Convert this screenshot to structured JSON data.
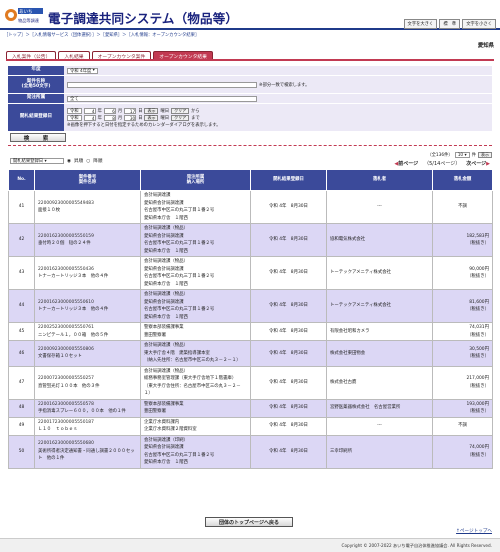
{
  "header": {
    "logo_text": "あいち物品等調達",
    "title": "電子調達共同システム（物品等）",
    "font_size_buttons": [
      "文字を大きく",
      "標　準",
      "文字を小さく"
    ]
  },
  "breadcrumb": "［トップ］＞［入札情報サービス（団体選択）］＞［愛知県］＞［入札情報：オープンカウンタ結果］",
  "region": "愛知県",
  "tabs": [
    {
      "label": "入札案件（公告）",
      "active": false
    },
    {
      "label": "入札結果",
      "active": false
    },
    {
      "label": "オープンカウンタ案件",
      "active": false
    },
    {
      "label": "オープンカウンタ結果",
      "active": true
    }
  ],
  "search": {
    "year_label": "年度",
    "year_value": "令和 4年度",
    "name_label": "案件名称\n(全角50文字)",
    "name_note": "※部分一致で検索します。",
    "dept_label": "発注所属",
    "dept_value": "全て",
    "date_label": "開札結果登録日",
    "from": {
      "era": "令和",
      "year": "4",
      "month": "6",
      "day": "17",
      "cal": "表示",
      "clear": "クリア",
      "suffix": "から"
    },
    "to": {
      "era": "令和",
      "year": "4",
      "month": "8",
      "day": "30",
      "cal": "表示",
      "clear": "クリア",
      "suffix": "まで"
    },
    "date_note": "※画像を押下すると日付を指定するためのカレンダーダイアログを表示します。",
    "search_button": "検　索"
  },
  "controls": {
    "sort_value": "開札結果登録日",
    "asc": "昇順",
    "desc": "降順",
    "total": "（全136件）",
    "per_page": "10",
    "per_page_suffix": "件",
    "display": "表示",
    "prev": "前ページ",
    "page": "（5/14ページ）",
    "next": "次ページ"
  },
  "table": {
    "headers": [
      "No.",
      "案件番号\n案件名称",
      "発注所属\n納入場所",
      "開札結果登録日",
      "落札者",
      "落札金額"
    ],
    "rows": [
      {
        "no": "41",
        "id": "22000923000005549483",
        "name": "面接１０枚",
        "dept": [
          "会計局調達課",
          "愛知県会計局調達課",
          "名古屋市中区三の丸三丁目１番２号",
          "愛知県本庁舎　１階西"
        ],
        "date": "令和 4年　8月30日",
        "winner": "---",
        "amount": [
          "不調"
        ]
      },
      {
        "no": "42",
        "id": "22001623000005550159",
        "name": "垂付時２０個　短の２４件",
        "dept": [
          "会計局調達課（物品）",
          "愛知県会計局調達課",
          "名古屋市中区三の丸三丁目１番２号",
          "愛知県本庁舎　１階西"
        ],
        "date": "令和 4年　8月30日",
        "winner": "協和電気株式会社",
        "amount": [
          "182,583円",
          "（税抜き）"
        ]
      },
      {
        "no": "43",
        "id": "22001623000005550436",
        "name": "トナーカートリッジ３本　他の４件",
        "dept": [
          "会計局調達課（物品）",
          "愛知県会計局調達課",
          "名古屋市中区三の丸三丁目１番２号",
          "愛知県本庁舎　１階西"
        ],
        "date": "令和 4年　8月30日",
        "winner": "トーテックアメニティ株式会社",
        "amount": [
          "90,000円",
          "（税抜き）"
        ]
      },
      {
        "no": "44",
        "id": "22001623000005550610",
        "name": "トナーカートリッジ３本　他の４件",
        "dept": [
          "会計局調達課（物品）",
          "愛知県会計局調達課",
          "名古屋市中区三の丸三丁目１番２号",
          "愛知県本庁舎　１階西"
        ],
        "date": "令和 4年　8月30日",
        "winner": "トーテックアメニティ株式会社",
        "amount": [
          "81,600円",
          "（税抜き）"
        ]
      },
      {
        "no": "45",
        "id": "22002523000005550761",
        "name": "ニンピテール１，００箱　他の５件",
        "dept": [
          "警察本部装備課事業",
          "豊田警察署"
        ],
        "date": "令和 4年　8月30日",
        "winner": "有限会社昭和カメラ",
        "amount": [
          "74,031円",
          "（税抜き）"
        ]
      },
      {
        "no": "46",
        "id": "22000923000005550806",
        "name": "文書保存箱１０セット",
        "dept": [
          "会計局調達課（物品）",
          "東大手庁舎４階　建築指導課本室",
          "（納入先住所：名古屋市中区三の丸３－２－１）"
        ],
        "date": "令和 4年　8月30日",
        "winner": "株式会社東田物会",
        "amount": [
          "30,500円",
          "（税抜き）"
        ]
      },
      {
        "no": "47",
        "id": "22000723000005550257",
        "name": "直管蛍光灯１００本　他の３件",
        "dept": [
          "会計局調達課（物品）",
          "総務事務室管理課（東大手庁舎地下１階書庫）",
          "（東大手庁舎住所：名古屋市中区三の丸３－２－１）"
        ],
        "date": "令和 4年　8月30日",
        "winner": "株式会社古鷹",
        "amount": [
          "217,000円",
          "（税抜き）"
        ]
      },
      {
        "no": "48",
        "id": "22001623000005550578",
        "name": "手指消毒スプレー６００，００本　他の１件",
        "dept": [
          "警察本部装備課事業",
          "豊田警察署"
        ],
        "date": "令和 4年　8月30日",
        "winner": "宮野医薬器株式会社　名古屋営業所",
        "amount": [
          "193,000円",
          "（税抜き）"
        ]
      },
      {
        "no": "49",
        "id": "22001723000005550187",
        "name": "Ｌ１０　ｔｏｂｅｓ",
        "dept": [
          "企業庁水資料課内",
          "企業庁水資料課２階資料室"
        ],
        "date": "令和 4年　8月30日",
        "winner": "---",
        "amount": [
          "不調"
        ]
      },
      {
        "no": "50",
        "id": "22001623000005550680",
        "name": "美術所得者決定通知書・同通し調書２０００セット　他の１件",
        "dept": [
          "会計局調達課（印刷）",
          "愛知県会計局調達課",
          "名古屋市中区三の丸三丁目１番２号",
          "愛知県本庁舎　１階西"
        ],
        "date": "令和 4年　8月30日",
        "winner": "三幸印刷所",
        "amount": [
          "74,000円",
          "（税抜き）"
        ]
      }
    ]
  },
  "back_button": "団体のトップページへ戻る",
  "page_top": "↑ページトップへ",
  "footer": "Copyright © 2007-2022 あいち電子自治体推進協議会. All Rights Reserved."
}
